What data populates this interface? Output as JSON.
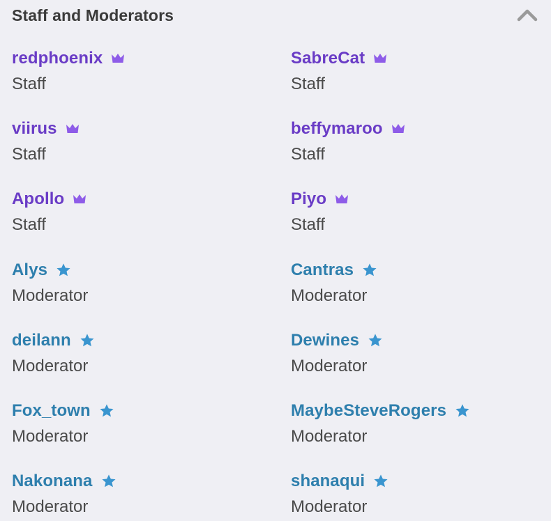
{
  "panel": {
    "title": "Staff and Moderators",
    "collapse_icon": "chevron-up-icon"
  },
  "colors": {
    "staff": "#6a3cc6",
    "staff_icon": "#8e5ce8",
    "moderator": "#2e7fad",
    "moderator_icon": "#3a95cf",
    "chevron": "#9a9a9a"
  },
  "members": [
    {
      "name": "redphoenix",
      "role": "Staff",
      "type": "staff",
      "icon": "crown-icon"
    },
    {
      "name": "SabreCat",
      "role": "Staff",
      "type": "staff",
      "icon": "crown-icon"
    },
    {
      "name": "viirus",
      "role": "Staff",
      "type": "staff",
      "icon": "crown-icon"
    },
    {
      "name": "beffymaroo",
      "role": "Staff",
      "type": "staff",
      "icon": "crown-icon"
    },
    {
      "name": "Apollo",
      "role": "Staff",
      "type": "staff",
      "icon": "crown-icon"
    },
    {
      "name": "Piyo",
      "role": "Staff",
      "type": "staff",
      "icon": "crown-icon"
    },
    {
      "name": "Alys",
      "role": "Moderator",
      "type": "moderator",
      "icon": "star-icon"
    },
    {
      "name": "Cantras",
      "role": "Moderator",
      "type": "moderator",
      "icon": "star-icon"
    },
    {
      "name": "deilann",
      "role": "Moderator",
      "type": "moderator",
      "icon": "star-icon"
    },
    {
      "name": "Dewines",
      "role": "Moderator",
      "type": "moderator",
      "icon": "star-icon"
    },
    {
      "name": "Fox_town",
      "role": "Moderator",
      "type": "moderator",
      "icon": "star-icon"
    },
    {
      "name": "MaybeSteveRogers",
      "role": "Moderator",
      "type": "moderator",
      "icon": "star-icon"
    },
    {
      "name": "Nakonana",
      "role": "Moderator",
      "type": "moderator",
      "icon": "star-icon"
    },
    {
      "name": "shanaqui",
      "role": "Moderator",
      "type": "moderator",
      "icon": "star-icon"
    }
  ]
}
